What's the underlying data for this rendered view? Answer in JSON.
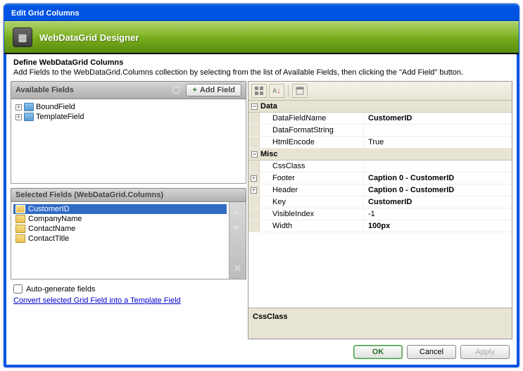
{
  "window": {
    "title": "Edit Grid Columns"
  },
  "banner": {
    "title": "WebDataGrid Designer"
  },
  "description": {
    "title": "Define WebDataGrid Columns",
    "text": "Add Fields to the WebDataGrid.Columns collection by selecting from the list of Available Fields, then clicking the \"Add Field\" button."
  },
  "availableFields": {
    "header": "Available Fields",
    "addFieldLabel": "Add Field",
    "items": [
      {
        "label": "BoundField"
      },
      {
        "label": "TemplateField"
      }
    ]
  },
  "selectedFields": {
    "header": "Selected Fields (WebDataGrid.Columns)",
    "items": [
      {
        "label": "CustomerID",
        "selected": true
      },
      {
        "label": "CompanyName",
        "selected": false
      },
      {
        "label": "ContactName",
        "selected": false
      },
      {
        "label": "ContactTitle",
        "selected": false
      }
    ]
  },
  "options": {
    "autoGenerateLabel": "Auto-generate fields",
    "convertLink": "Convert selected Grid Field into a Template Field"
  },
  "propertyGrid": {
    "categories": [
      {
        "name": "Data",
        "expanded": true,
        "rows": [
          {
            "name": "DataFieldName",
            "value": "CustomerID",
            "bold": true
          },
          {
            "name": "DataFormatString",
            "value": ""
          },
          {
            "name": "HtmlEncode",
            "value": "True"
          }
        ]
      },
      {
        "name": "Misc",
        "expanded": true,
        "rows": [
          {
            "name": "CssClass",
            "value": ""
          },
          {
            "name": "Footer",
            "value": "Caption 0 - CustomerID",
            "bold": true,
            "expandable": true
          },
          {
            "name": "Header",
            "value": "Caption 0 - CustomerID",
            "bold": true,
            "expandable": true
          },
          {
            "name": "Key",
            "value": "CustomerID",
            "bold": true
          },
          {
            "name": "VisibleIndex",
            "value": "-1"
          },
          {
            "name": "Width",
            "value": "100px",
            "bold": true
          }
        ]
      }
    ],
    "descriptionTitle": "CssClass"
  },
  "buttons": {
    "ok": "OK",
    "cancel": "Cancel",
    "apply": "Apply"
  }
}
